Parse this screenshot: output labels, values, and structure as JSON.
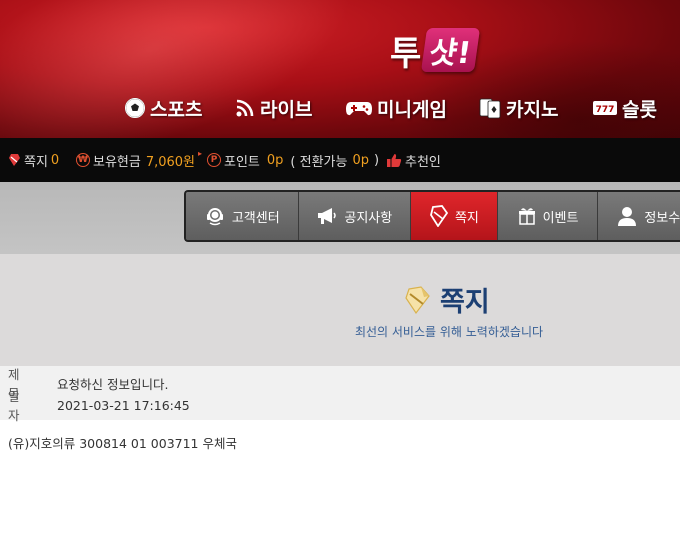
{
  "logo": {
    "part1": "투",
    "part2": "샷!"
  },
  "nav": [
    {
      "label": "스포츠",
      "icon": "soccer-ball-icon"
    },
    {
      "label": "라이브",
      "icon": "live-signal-icon"
    },
    {
      "label": "미니게임",
      "icon": "gamepad-icon"
    },
    {
      "label": "카지노",
      "icon": "playing-cards-icon"
    },
    {
      "label": "슬롯",
      "icon": "slot-777-icon"
    }
  ],
  "infobar": {
    "message_label": "쪽지",
    "message_count": "0",
    "cash_label": "보유현금",
    "cash_value": "7,060원",
    "point_label": "포인트",
    "point_value": "0p",
    "convert_open": "( 전환가능",
    "convert_value": "0p",
    "convert_close": ")",
    "recommend_label": "추천인"
  },
  "subnav": [
    {
      "label": "고객센터",
      "icon": "headset-icon",
      "active": false
    },
    {
      "label": "공지사항",
      "icon": "megaphone-icon",
      "active": false
    },
    {
      "label": "쪽지",
      "icon": "message-note-icon",
      "active": true
    },
    {
      "label": "이벤트",
      "icon": "gift-icon",
      "active": false
    },
    {
      "label": "정보수",
      "icon": "user-icon",
      "active": false
    }
  ],
  "page": {
    "title": "쪽지",
    "subtitle": "최선의 서비스를 위해 노력하겠습니다"
  },
  "message": {
    "subject_label": "제목",
    "subject": "요청하신 정보입니다.",
    "date_label": "일자",
    "date": "2021-03-21 17:16:45",
    "body": "(유)지호의류 300814 01 003711 우체국"
  },
  "colors": {
    "brand_red": "#c8161d",
    "accent_orange": "#f0a020",
    "title_blue": "#1c3f73"
  }
}
